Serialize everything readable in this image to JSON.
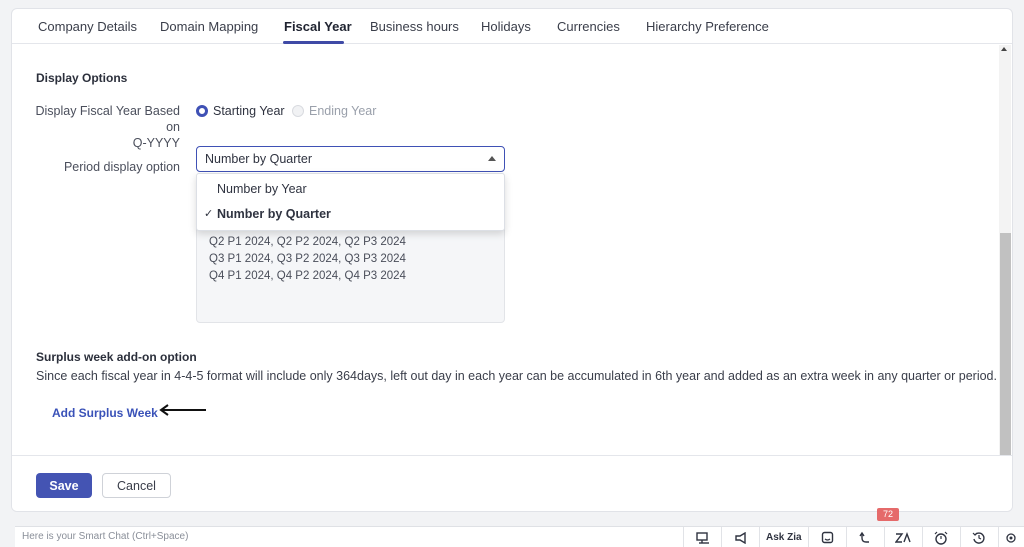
{
  "tabs": [
    {
      "label": "Company Details"
    },
    {
      "label": "Domain Mapping"
    },
    {
      "label": "Fiscal Year"
    },
    {
      "label": "Business hours"
    },
    {
      "label": "Holidays"
    },
    {
      "label": "Currencies"
    },
    {
      "label": "Hierarchy Preference"
    }
  ],
  "display_options": {
    "title": "Display Options",
    "fiscal_label_line1": "Display Fiscal Year Based on",
    "fiscal_label_line2": "Q-YYYY",
    "radio_starting": "Starting Year",
    "radio_ending": "Ending Year",
    "period_label": "Period display option",
    "period_selected": "Number by Quarter",
    "dropdown_options": [
      "Number by Year",
      "Number by Quarter"
    ],
    "check_mark": "✓",
    "preview_lines": [
      "Q2 P1 2024, Q2 P2 2024, Q2 P3 2024",
      "Q3 P1 2024, Q3 P2 2024, Q3 P3 2024",
      "Q4 P1 2024, Q4 P2 2024, Q4 P3 2024"
    ]
  },
  "surplus": {
    "title": "Surplus week add-on option",
    "description": "Since each fiscal year in 4-4-5 format will include only 364days, left out day in each year can be accumulated in 6th year and added as an extra week in any quarter or period.",
    "link": "Add Surplus Week"
  },
  "footer": {
    "save": "Save",
    "cancel": "Cancel"
  },
  "bottom_bar": {
    "smart_chat_placeholder": "Here is your Smart Chat (Ctrl+Space)",
    "ask_zia": "Ask Zia",
    "notification_count": "72"
  },
  "colors": {
    "accent": "#3f51b5",
    "link": "#3a52b8",
    "badge": "#e56a6a"
  }
}
